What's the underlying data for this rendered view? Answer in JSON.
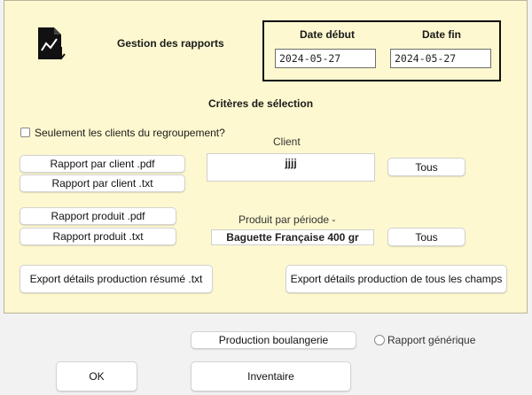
{
  "header": {
    "title": "Gestion des rapports",
    "icon": "report-chart-icon"
  },
  "dates": {
    "start_label": "Date début",
    "start_value": "2024-05-27",
    "end_label": "Date fin",
    "end_value": "2024-05-27"
  },
  "criteria": {
    "title": "Critères de sélection",
    "group_checkbox_label": "Seulement les clients du regroupement?",
    "group_checkbox_checked": false,
    "client_label": "Client",
    "client_value": "jjjj",
    "client_all_button": "Tous",
    "product_label": "Produit par période -",
    "product_value": "Baguette Française 400 gr",
    "product_all_button": "Tous"
  },
  "buttons": {
    "client_pdf": "Rapport par client .pdf",
    "client_txt": "Rapport par client .txt",
    "product_pdf": "Rapport produit .pdf",
    "product_txt": "Rapport produit .txt",
    "export_summary": "Export détails production résumé .txt",
    "export_all": "Export détails production de tous les champs",
    "bakery_production": "Production boulangerie",
    "inventory": "Inventaire",
    "ok": "OK"
  },
  "generic_report": {
    "label": "Rapport générique",
    "selected": false
  }
}
